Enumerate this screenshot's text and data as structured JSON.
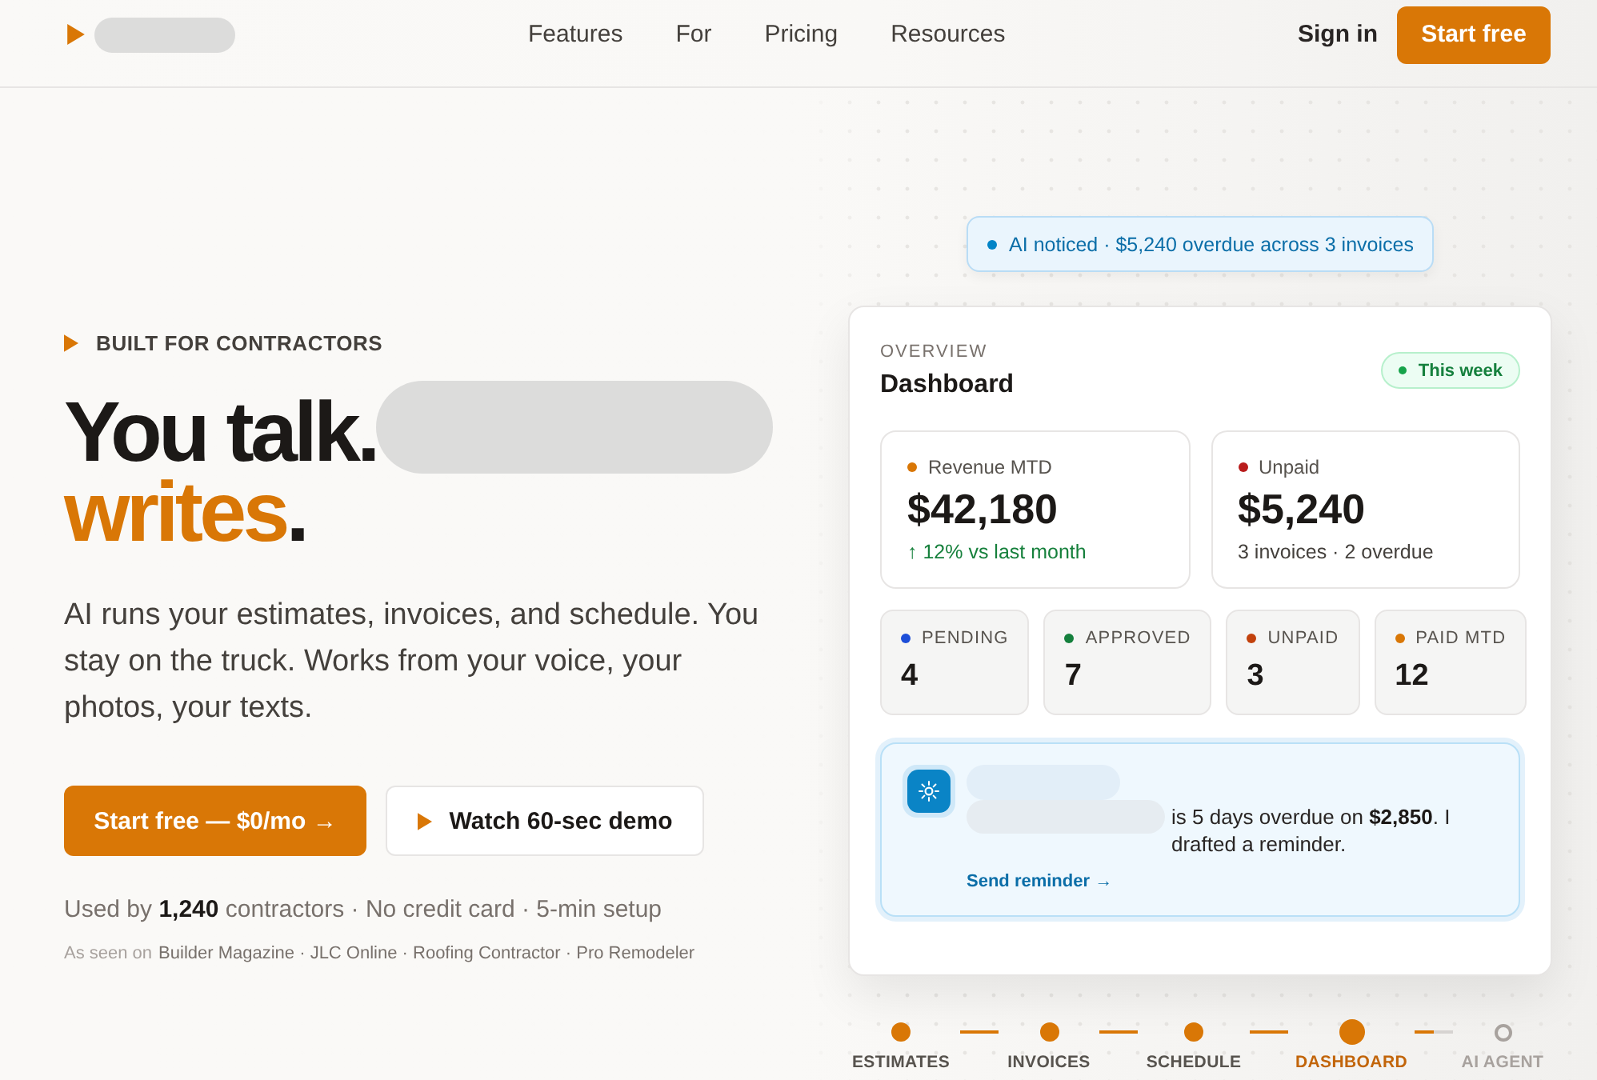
{
  "nav": {
    "links": [
      "Features",
      "For",
      "Pricing",
      "Resources"
    ],
    "sign_in": "Sign in",
    "cta": "Start free"
  },
  "hero": {
    "eyebrow": "BUILT FOR CONTRACTORS",
    "headline": {
      "line_1": "You talk.",
      "accent": "writes",
      "end": "."
    },
    "body": "AI runs your estimates, invoices, and schedule. You stay on the truck. Works from your voice, your photos, your texts.",
    "primary_button": "Start free — $0/mo →",
    "secondary_button": "Watch 60-sec demo",
    "social_proof": "Used by **1,240** contractors · No credit card · 5-min setup",
    "press": {
      "label": "As seen on",
      "outlets": "Builder Magazine · JLC Online · Roofing Contractor · Pro Remodeler"
    }
  },
  "ai_notice": "AI noticed · $5,240 overdue across 3 invoices",
  "dashboard": {
    "eyebrow": "OVERVIEW",
    "title": "Dashboard",
    "period": "This week",
    "metrics": [
      {
        "label": "Revenue MTD",
        "color": "#d97706",
        "value": "$42,180",
        "note": "↑ 12% vs last month",
        "kind": "trend"
      },
      {
        "label": "Unpaid",
        "color": "#b91c1c",
        "value": "$5,240",
        "note": "3 invoices · 2 overdue",
        "kind": "plain"
      }
    ],
    "counts": [
      {
        "label": "PENDING",
        "color": "#1d4ed8",
        "value": "4"
      },
      {
        "label": "APPROVED",
        "color": "#15803d",
        "value": "7"
      },
      {
        "label": "UNPAID",
        "color": "#c2410c",
        "value": "3"
      },
      {
        "label": "PAID MTD",
        "color": "#d97706",
        "value": "12"
      }
    ],
    "ai_card": {
      "message": "is 5 days overdue on **$2,850**. I drafted a reminder.",
      "action": "Send reminder →"
    }
  },
  "steps": [
    {
      "label": "ESTIMATES",
      "done": true,
      "selected": false
    },
    {
      "label": "INVOICES",
      "done": true,
      "selected": false
    },
    {
      "label": "SCHEDULE",
      "done": true,
      "selected": false
    },
    {
      "label": "DASHBOARD",
      "done": true,
      "selected": true
    },
    {
      "label": "AI AGENT",
      "done": false,
      "selected": false
    }
  ],
  "connectors": [
    {
      "level": 1
    },
    {
      "level": 1
    },
    {
      "level": 1
    },
    {
      "level": 0.5
    }
  ]
}
